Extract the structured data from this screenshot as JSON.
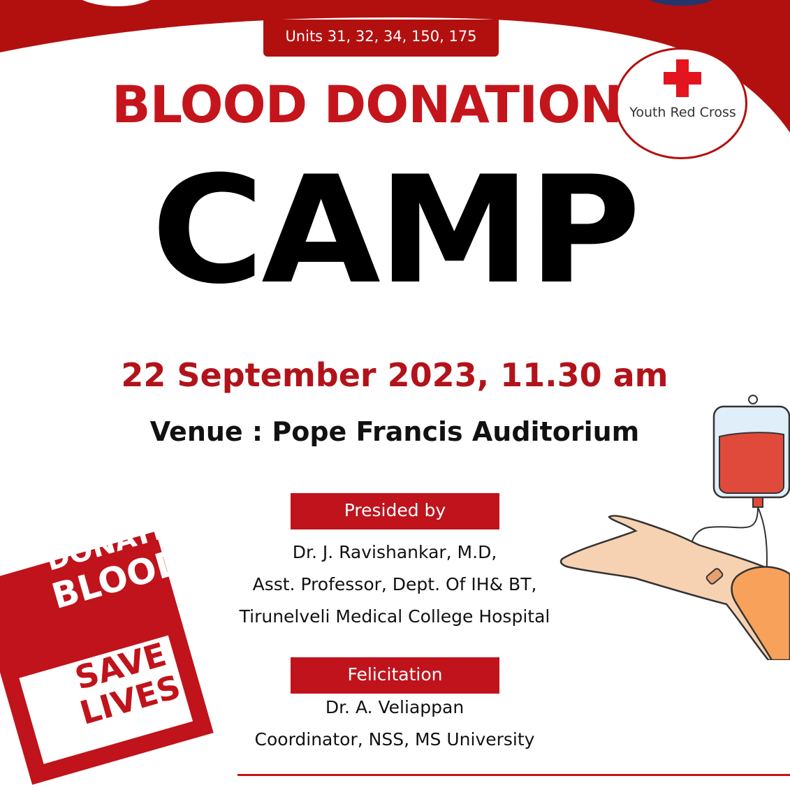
{
  "header": {
    "units": "Units 31, 32, 34, 150, 175"
  },
  "title": {
    "line1": "BLOOD DONATION",
    "line2": "CAMP"
  },
  "logo": {
    "name": "Youth Red Cross",
    "icon": "red-cross-icon"
  },
  "event": {
    "date_time": "22 September 2023, 11.30 am",
    "venue": "Venue : Pope Francis Auditorium"
  },
  "presided": {
    "label": "Presided by",
    "lines": [
      "Dr. J. Ravishankar, M.D,",
      "Asst. Professor, Dept. Of IH& BT,",
      "Tirunelveli Medical College Hospital"
    ]
  },
  "felicitation": {
    "label": "Felicitation",
    "lines": [
      "Dr. A. Veliappan",
      "Coordinator, NSS, MS University"
    ]
  },
  "stamp": {
    "line1": "DONATE",
    "line2": "BLOOD",
    "line3": "SAVE",
    "line4": "LIVES"
  },
  "colors": {
    "primary_red": "#b2100f",
    "title_red": "#c4151c",
    "text_black": "#111111",
    "background": "#ffffff"
  }
}
